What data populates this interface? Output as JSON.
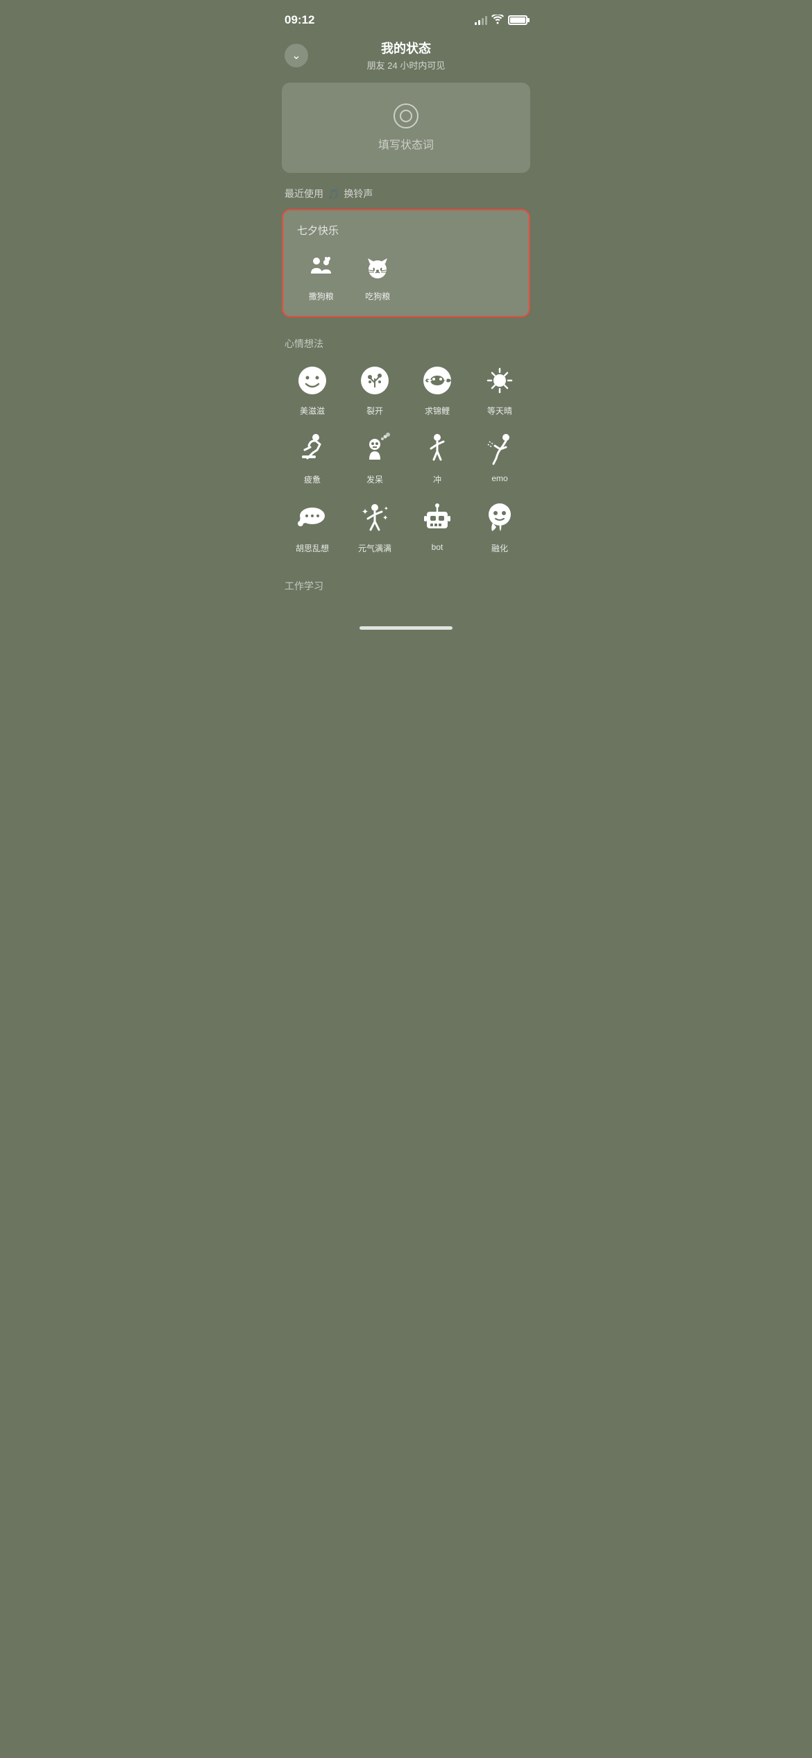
{
  "statusBar": {
    "time": "09:12"
  },
  "header": {
    "title": "我的状态",
    "subtitle": "朋友 24 小时内可见",
    "backIcon": "chevron-down"
  },
  "inputArea": {
    "placeholder": "填写状态词"
  },
  "recentSection": {
    "label": "最近使用",
    "ringtoneLabel": "换铃声"
  },
  "highlightCard": {
    "title": "七夕快乐",
    "items": [
      {
        "label": "撒狗粮",
        "emoji": "couple"
      },
      {
        "label": "吃狗粮",
        "emoji": "cat-face"
      }
    ]
  },
  "moodSection": {
    "title": "心情想法",
    "items": [
      {
        "label": "美滋滋",
        "emoji": "smile"
      },
      {
        "label": "裂开",
        "emoji": "sprout"
      },
      {
        "label": "求锦鲤",
        "emoji": "koi"
      },
      {
        "label": "等天晴",
        "emoji": "sun"
      },
      {
        "label": "疲惫",
        "emoji": "tired"
      },
      {
        "label": "发呆",
        "emoji": "daze"
      },
      {
        "label": "冲",
        "emoji": "run"
      },
      {
        "label": "emo",
        "emoji": "emo"
      },
      {
        "label": "胡思乱想",
        "emoji": "cloud"
      },
      {
        "label": "元气满满",
        "emoji": "energy"
      },
      {
        "label": "bot",
        "emoji": "robot"
      },
      {
        "label": "融化",
        "emoji": "melt"
      }
    ]
  },
  "workSection": {
    "title": "工作学习"
  },
  "bottomNav": {
    "items": [
      {
        "icon": "chat",
        "label": ""
      },
      {
        "icon": "contacts",
        "label": ""
      },
      {
        "icon": "discover",
        "label": ""
      },
      {
        "icon": "profile",
        "label": ""
      }
    ]
  }
}
